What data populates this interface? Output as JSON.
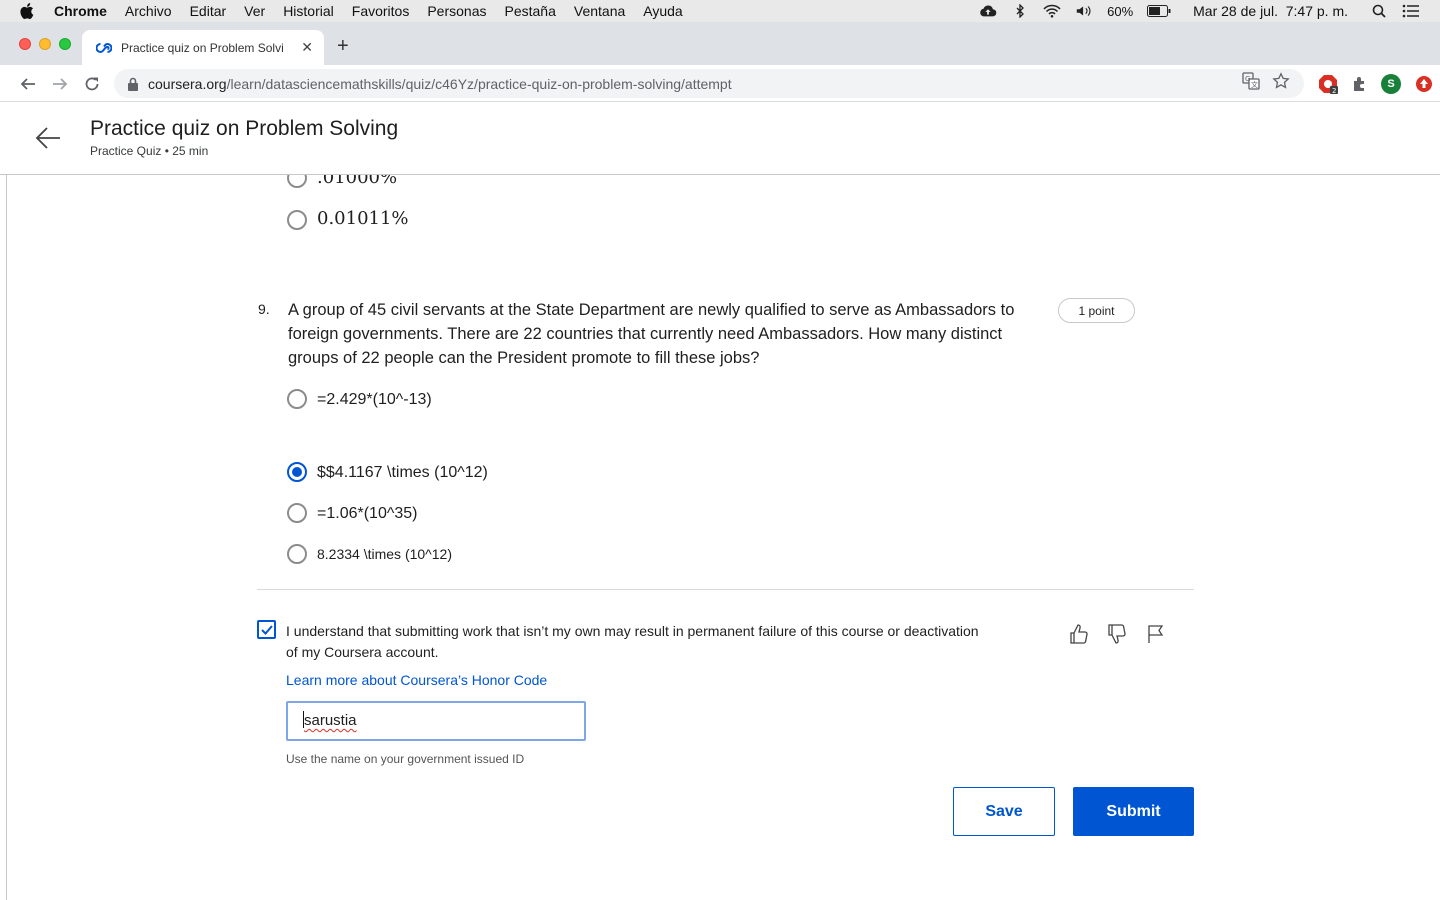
{
  "menubar": {
    "items": [
      "Chrome",
      "Archivo",
      "Editar",
      "Ver",
      "Historial",
      "Favoritos",
      "Personas",
      "Pestaña",
      "Ventana",
      "Ayuda"
    ],
    "battery": "60%",
    "datetime": "Mar 28 de jul.  7:47 p. m."
  },
  "browser": {
    "tab_title": "Practice quiz on Problem Solvi",
    "url_host": "coursera.org",
    "url_path": "/learn/datasciencemathskills/quiz/c46Yz/practice-quiz-on-problem-solving/attempt",
    "extension_badge": "2",
    "profile_initial": "S"
  },
  "page": {
    "title": "Practice quiz on Problem Solving",
    "subtitle": "Practice Quiz • 25 min"
  },
  "prev_question": {
    "options": [
      ".01000%",
      "0.01011%"
    ]
  },
  "question": {
    "number": "9.",
    "text": "A group of 45 civil servants at the State Department are newly qualified to serve as Ambassadors to foreign governments. There are 22 countries that currently need Ambassadors. How many distinct groups of 22 people can the President promote to fill these jobs?",
    "points": "1 point",
    "options": [
      {
        "label": "=2.429*(10^-13)",
        "selected": false
      },
      {
        "label": "$$4.1167 \\times (10^12)",
        "selected": true
      },
      {
        "label": "=1.06*(10^35)",
        "selected": false
      },
      {
        "label": "8.2334 \\times (10^12)",
        "selected": false
      }
    ]
  },
  "honor": {
    "checked": true,
    "text": "I understand that submitting work that isn’t my own may result in permanent failure of this course or deactivation of my Coursera account.",
    "link": "Learn more about Coursera’s Honor Code",
    "name_value": "sarustia",
    "helper": "Use the name on your government issued ID"
  },
  "actions": {
    "save": "Save",
    "submit": "Submit"
  },
  "colors": {
    "accent": "#0056d2"
  }
}
